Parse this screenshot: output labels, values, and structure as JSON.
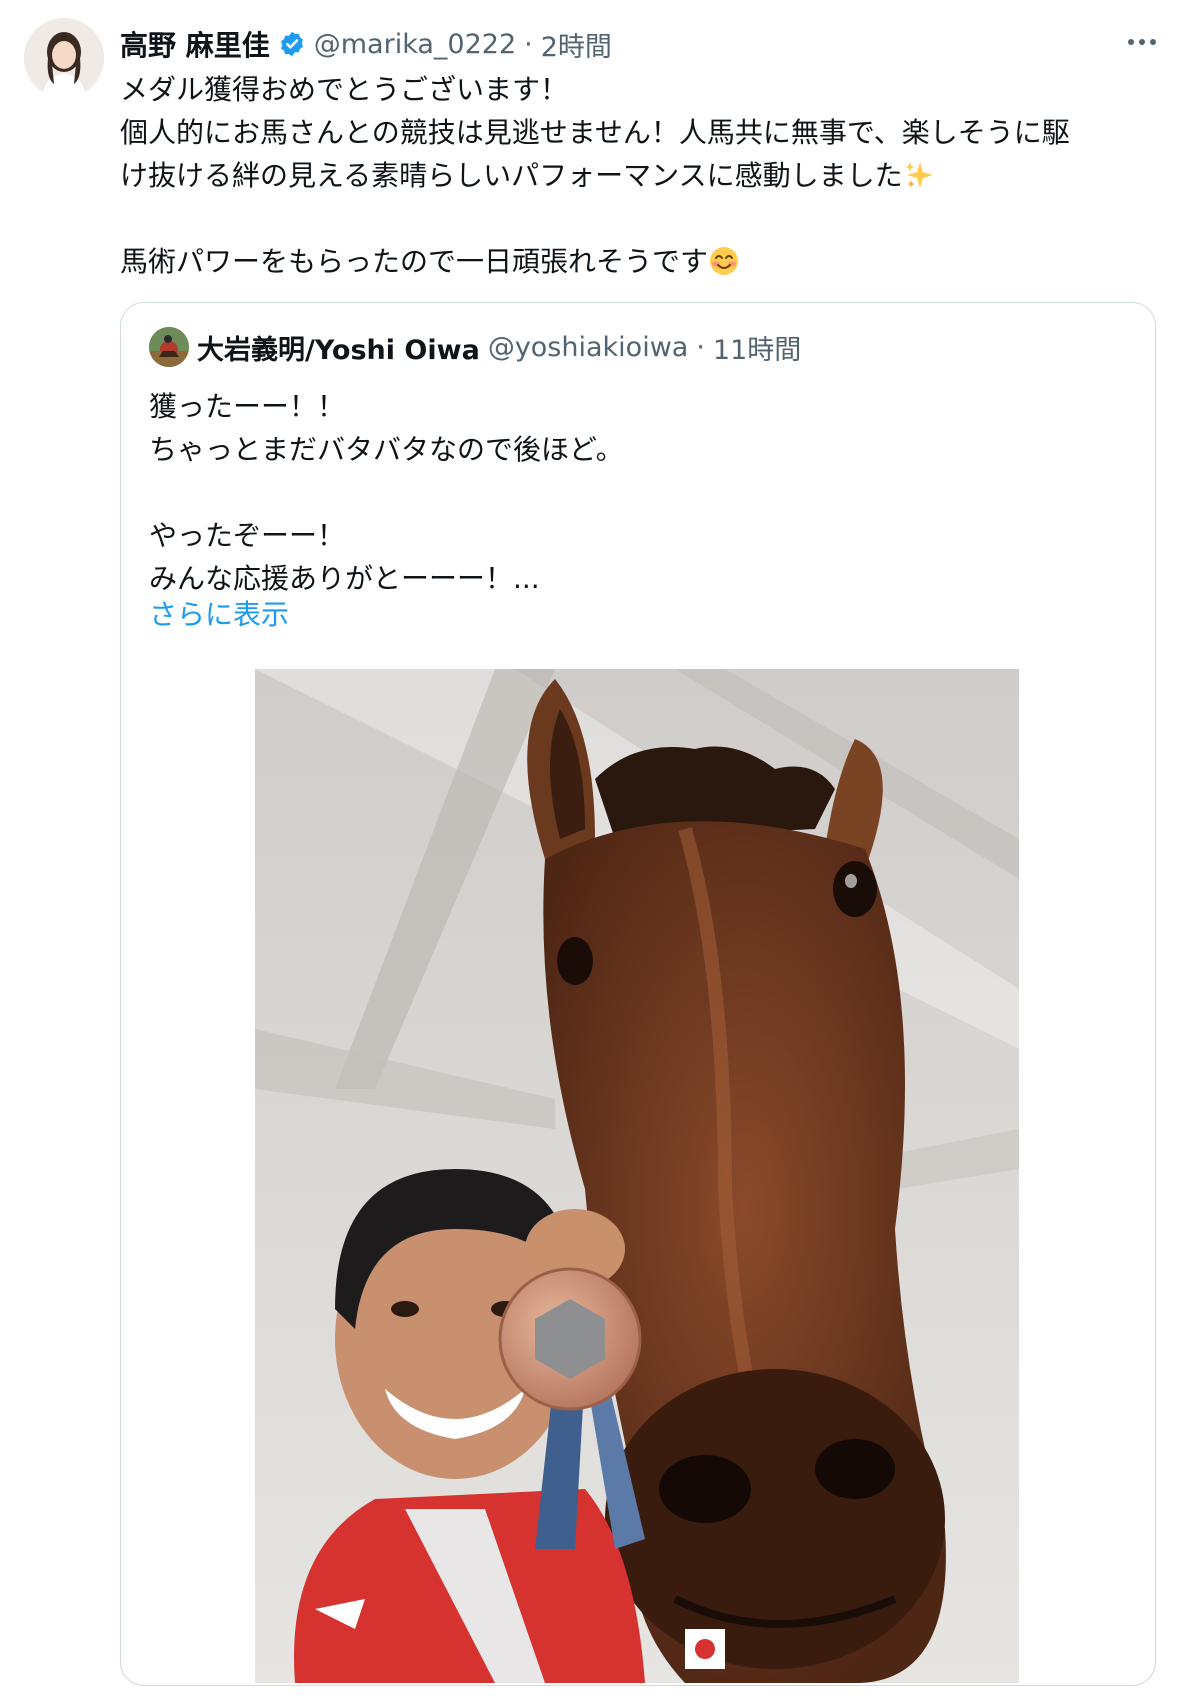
{
  "author": {
    "display_name": "高野 麻里佳",
    "handle": "@marika_0222",
    "separator": "·",
    "time": "2時間",
    "verified": true,
    "verified_color": "#1d9bf0"
  },
  "tweet": {
    "lines": [
      "メダル獲得おめでとうございます！",
      "個人的にお馬さんとの競技は見逃せません！人馬共に無事で、楽しそうに駆",
      "け抜ける絆の見える素晴らしいパフォーマンスに感動しました",
      "",
      "馬術パワーをもらったので一日頑張れそうです"
    ],
    "emoji_line3": "sparkles-emoji",
    "emoji_line5": "smiling-face-emoji"
  },
  "quote": {
    "display_name": "大岩義明/Yoshi Oiwa",
    "handle": "@yoshiakioiwa",
    "separator": "·",
    "time": "11時間",
    "lines": [
      "獲ったーー！！",
      "ちゃっとまだバタバタなので後ほど。",
      "",
      "やったぞーー！",
      "みんな応援ありがとーーー！..."
    ],
    "show_more": "さらに表示"
  },
  "photo": {
    "subject": "rider-with-bronze-medal-and-horse-selfie"
  },
  "colors": {
    "text_primary": "#0f1419",
    "text_secondary": "#536471",
    "link": "#1d9bf0",
    "border": "#cfd9de"
  }
}
